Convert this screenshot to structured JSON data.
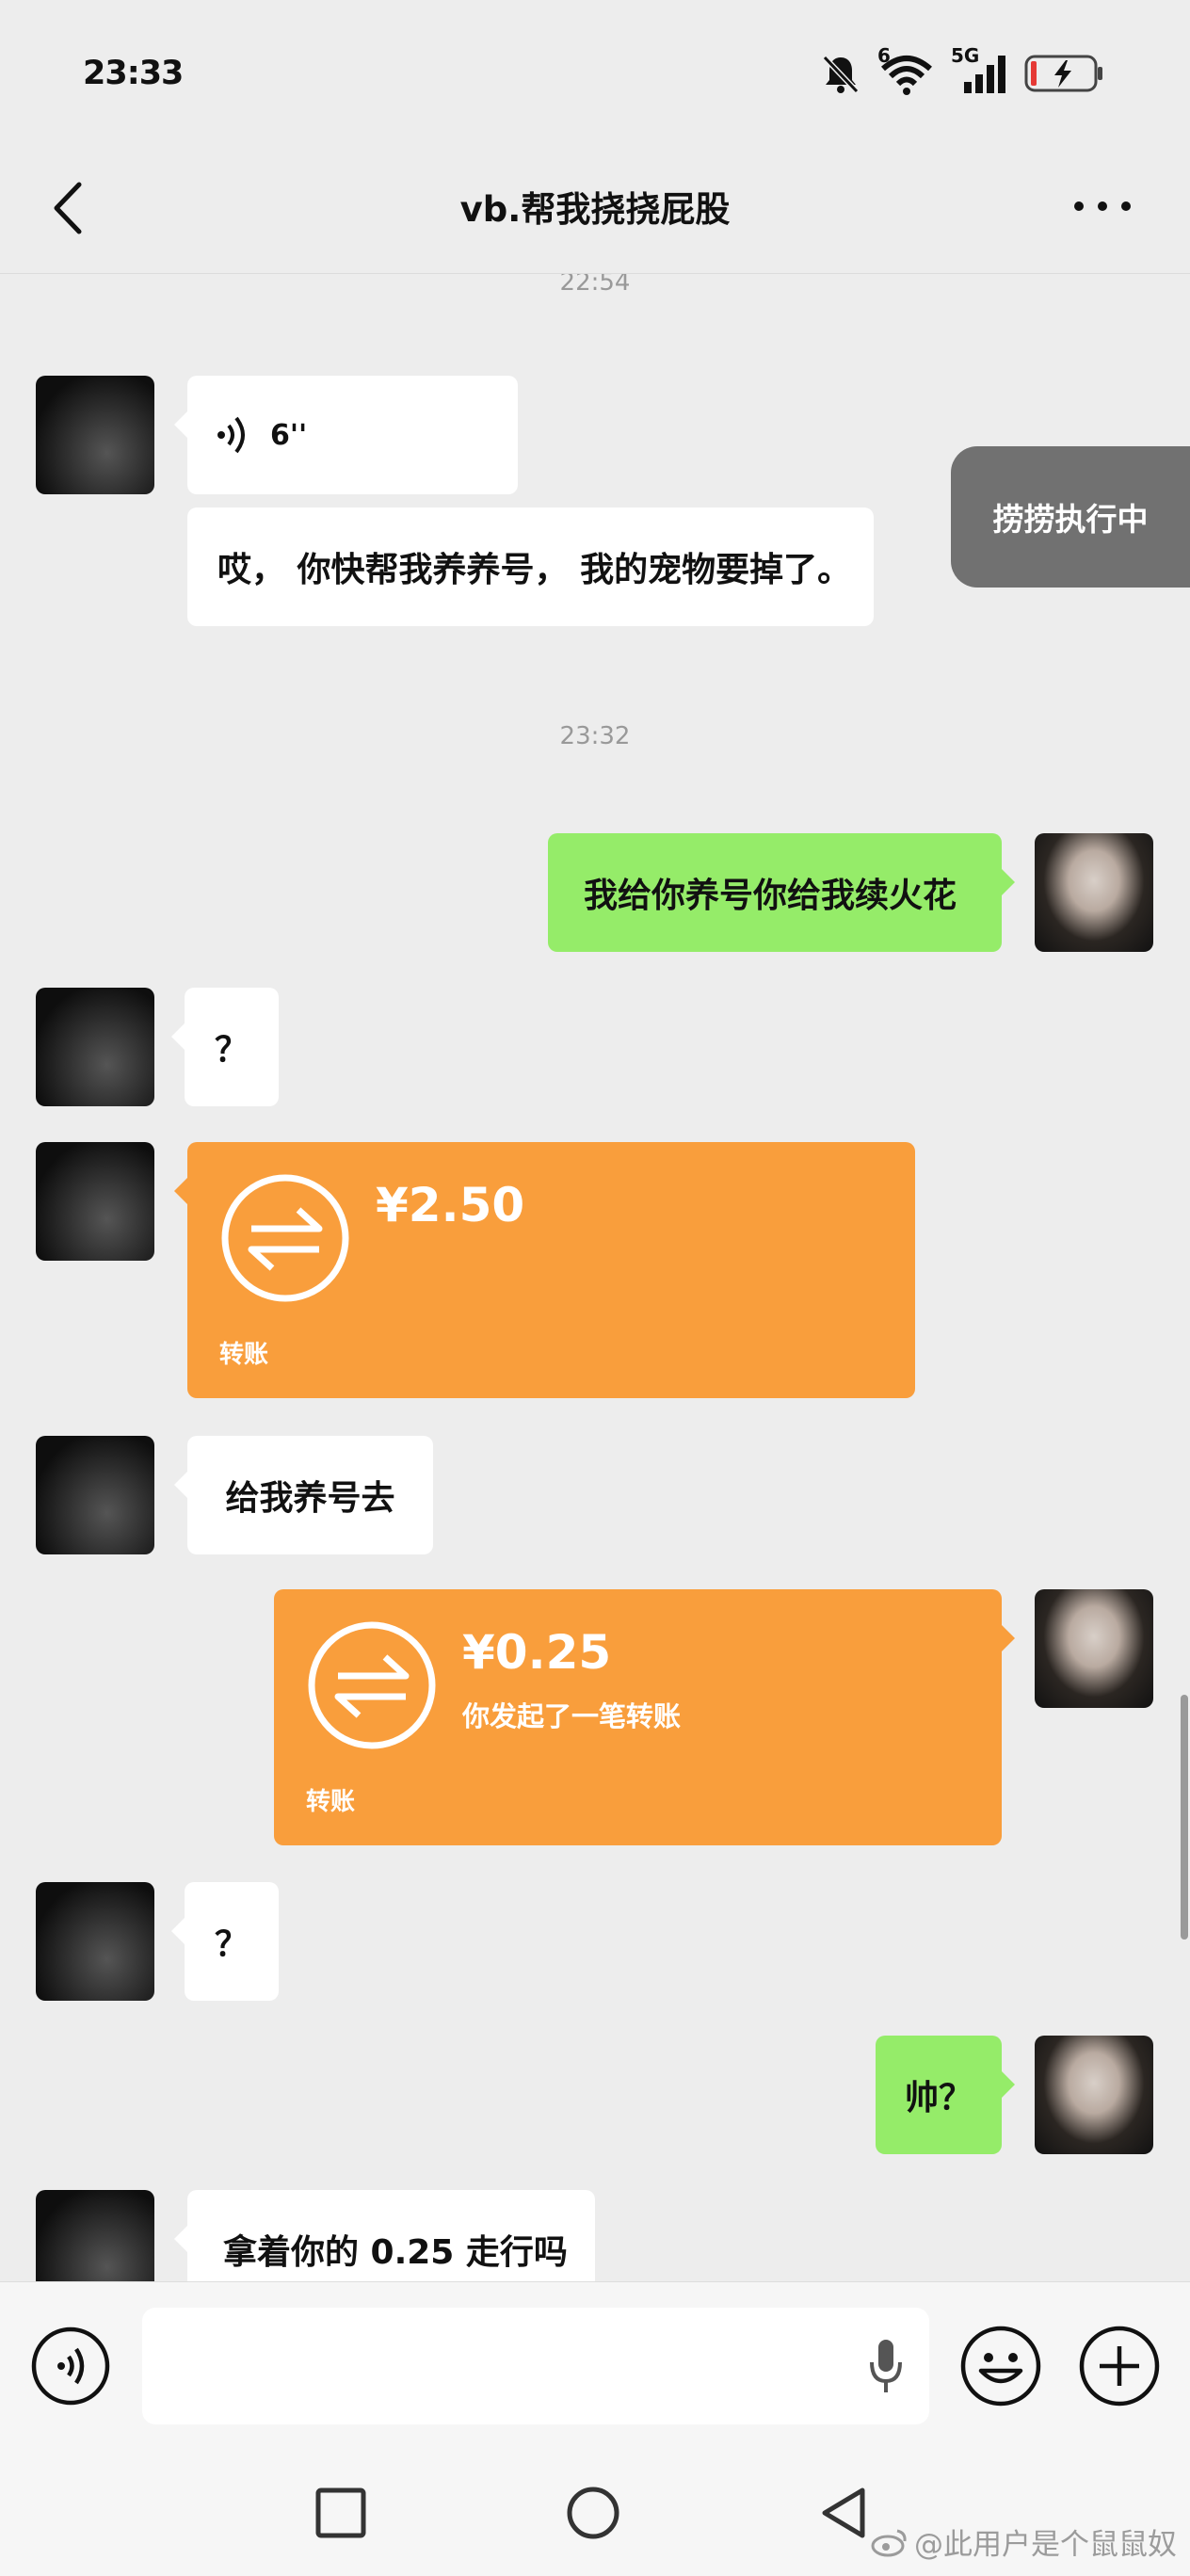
{
  "status_bar": {
    "time": "23:33",
    "wifi_badge": "6",
    "cell_badge": "5G",
    "icons": [
      "mute-bell-icon",
      "wifi-icon",
      "signal-icon",
      "battery-charging-icon"
    ]
  },
  "header": {
    "title": "vb.帮我挠挠屁股",
    "back_icon": "chevron-left-icon",
    "more_icon": "more-dots-icon"
  },
  "messages": {
    "ts1": "22:54",
    "voice_duration": "6''",
    "m2": "哎， 你快帮我养养号， 我的宠物要掉了。",
    "ts2": "23:32",
    "m3": "我给你养号你给我续火花",
    "m4": "？",
    "transfer1": {
      "amount": "¥2.50",
      "subtitle": "",
      "label": "转账"
    },
    "m6": "给我养号去",
    "transfer2": {
      "amount": "¥0.25",
      "subtitle": "你发起了一笔转账",
      "label": "转账"
    },
    "m8": "？",
    "m9": "帅？",
    "m10": "拿着你的 0.25 走行吗"
  },
  "toast": {
    "text": "捞捞执行中"
  },
  "input_bar": {
    "placeholder": "",
    "icons": [
      "voice-input-icon",
      "microphone-icon",
      "emoji-icon",
      "plus-icon"
    ]
  },
  "system_nav": {
    "icons": [
      "recents-square-icon",
      "home-circle-icon",
      "back-triangle-icon"
    ]
  },
  "watermark": {
    "text": "@此用户是个鼠鼠奴"
  },
  "colors": {
    "background": "#ededed",
    "self_bubble": "#95ec69",
    "other_bubble": "#ffffff",
    "transfer": "#f99e3c"
  }
}
